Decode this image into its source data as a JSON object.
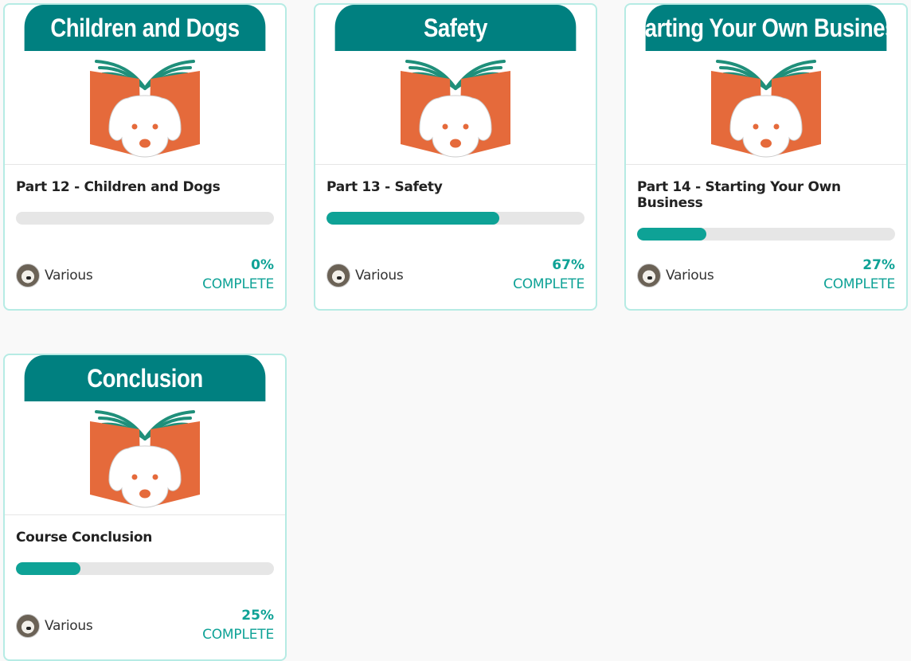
{
  "colors": {
    "banner": "#008080",
    "accent": "#0ea296",
    "book": "#e56a3b",
    "border": "#b6ebe4"
  },
  "cards": [
    {
      "banner": "Children and Dogs",
      "title": "Part 12 - Children and Dogs",
      "progress": 0,
      "progress_label": "0%",
      "author": "Various",
      "status": "COMPLETE",
      "image": "book-dog-logo"
    },
    {
      "banner": "Safety",
      "title": "Part 13 - Safety",
      "progress": 67,
      "progress_label": "67%",
      "author": "Various",
      "status": "COMPLETE",
      "image": "book-dog-logo"
    },
    {
      "banner": "Starting Your Own Business",
      "title": "Part 14 - Starting Your Own Business",
      "progress": 27,
      "progress_label": "27%",
      "author": "Various",
      "status": "COMPLETE",
      "image": "book-dog-logo"
    },
    {
      "banner": "Conclusion",
      "title": "Course Conclusion",
      "progress": 25,
      "progress_label": "25%",
      "author": "Various",
      "status": "COMPLETE",
      "image": "book-dog-logo"
    }
  ]
}
